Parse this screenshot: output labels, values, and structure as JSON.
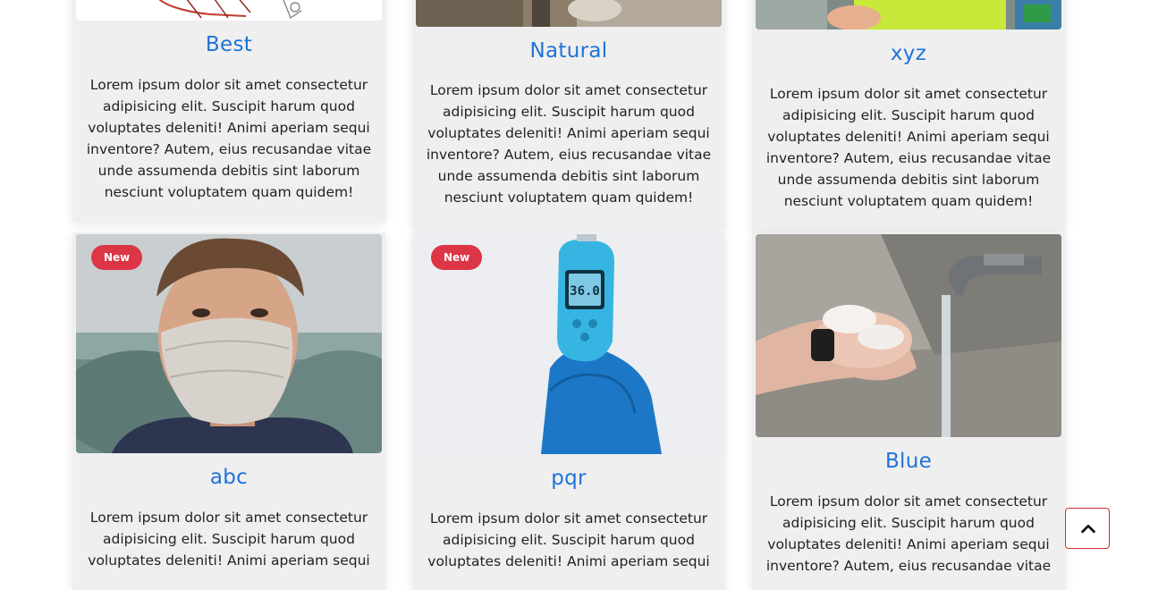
{
  "cards": [
    {
      "title": "Best",
      "badge": "",
      "description": "Lorem ipsum dolor sit amet consectetur adipisicing elit. Suscipit harum quod voluptates deleniti! Animi aperiam sequi inventore? Autem, eius recusandae vitae unde assumenda debitis sint laborum nesciunt voluptatem quam quidem!",
      "image_icon": "sketch-image"
    },
    {
      "title": "Natural",
      "badge": "",
      "description": "Lorem ipsum dolor sit amet consectetur adipisicing elit. Suscipit harum quod voluptates deleniti! Animi aperiam sequi inventore? Autem, eius recusandae vitae unde assumenda debitis sint laborum nesciunt voluptatem quam quidem!",
      "image_icon": "sanitizer-image"
    },
    {
      "title": "xyz",
      "badge": "",
      "description": "Lorem ipsum dolor sit amet consectetur adipisicing elit. Suscipit harum quod voluptates deleniti! Animi aperiam sequi inventore? Autem, eius recusandae vitae unde assumenda debitis sint laborum nesciunt voluptatem quam quidem!",
      "image_icon": "child-image"
    },
    {
      "title": "abc",
      "badge": "New",
      "description": "Lorem ipsum dolor sit amet consectetur adipisicing elit. Suscipit harum quod voluptates deleniti! Animi aperiam sequi",
      "image_icon": "masked-boy-image"
    },
    {
      "title": "pqr",
      "badge": "New",
      "description": "Lorem ipsum dolor sit amet consectetur adipisicing elit. Suscipit harum quod voluptates deleniti! Animi aperiam sequi",
      "image_icon": "thermometer-gun-image"
    },
    {
      "title": "Blue",
      "badge": "",
      "description": "Lorem ipsum dolor sit amet consectetur adipisicing elit. Suscipit harum quod voluptates deleniti! Animi aperiam sequi inventore? Autem, eius recusandae vitae",
      "image_icon": "hand-washing-image"
    }
  ],
  "scroll_top_icon": "chevron-up-icon",
  "colors": {
    "title": "#1f73d8",
    "badge": "#dc3545",
    "card_bg": "#efefef",
    "scroll_border": "#d32f2f"
  }
}
